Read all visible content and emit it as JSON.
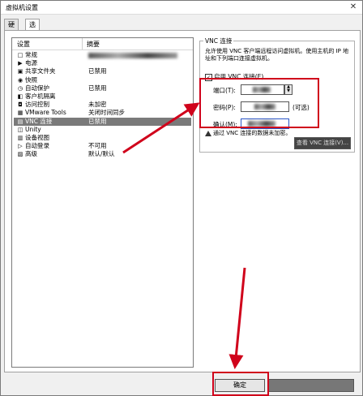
{
  "window": {
    "title": "虚拟机设置",
    "close_glyph": "✕"
  },
  "tabs": [
    {
      "label": "硬件"
    },
    {
      "label": "选项"
    }
  ],
  "list": {
    "col_setting": "设置",
    "col_summary": "摘要",
    "rows": [
      {
        "icon": "□",
        "label": "常规",
        "value": ""
      },
      {
        "icon": "▶",
        "label": "电源",
        "value": ""
      },
      {
        "icon": "▣",
        "label": "共享文件夹",
        "value": "已禁用"
      },
      {
        "icon": "◉",
        "label": "快照",
        "value": ""
      },
      {
        "icon": "◷",
        "label": "自动保护",
        "value": "已禁用"
      },
      {
        "icon": "◧",
        "label": "客户机隔离",
        "value": ""
      },
      {
        "icon": "◘",
        "label": "访问控制",
        "value": "未加密"
      },
      {
        "icon": "▦",
        "label": "VMware Tools",
        "value": "关闭时间同步"
      },
      {
        "icon": "▤",
        "label": "VNC 连接",
        "value": "已禁用"
      },
      {
        "icon": "◫",
        "label": "Unity",
        "value": ""
      },
      {
        "icon": "▥",
        "label": "设备视图",
        "value": ""
      },
      {
        "icon": "▷",
        "label": "自动登录",
        "value": "不可用"
      },
      {
        "icon": "▨",
        "label": "高级",
        "value": "默认/默认"
      }
    ]
  },
  "vnc": {
    "group_title": "VNC 连接",
    "description": "允许使用 VNC 客户端远程访问虚拟机。使用主机的 IP 地址和下列端口连接虚拟机。",
    "enable_label": "启用 VNC 连接(E)",
    "port_label": "端口(T):",
    "password_label": "密码(P):",
    "optional_label": "(可选)",
    "confirm_label": "确认(M):",
    "warning": "通过 VNC 连接的数据未加密。",
    "view_button": "查看 VNC 连接(V)..."
  },
  "footer": {
    "ok_label": "确定",
    "cancel_label": ""
  }
}
